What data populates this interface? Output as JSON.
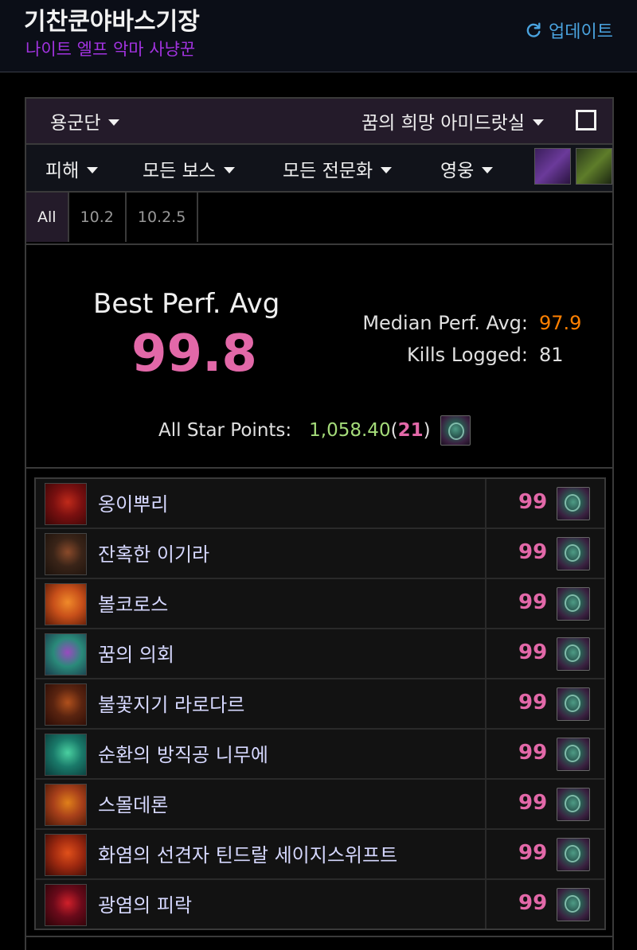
{
  "header": {
    "character_name": "기찬쿤야바스기장",
    "character_class": "나이트 엘프 악마 사냥꾼",
    "update_label": "업데이트"
  },
  "filters": {
    "region": "용군단",
    "raid": "꿈의 희망 아미드랏실",
    "metric": "피해",
    "boss": "모든 보스",
    "spec": "모든 전문화",
    "difficulty": "영웅"
  },
  "tabs": [
    "All",
    "10.2",
    "10.2.5"
  ],
  "summary": {
    "best_label": "Best Perf. Avg",
    "best_value": "99.8",
    "median_label": "Median Perf. Avg:",
    "median_value": "97.9",
    "kills_label": "Kills Logged:",
    "kills_value": "81",
    "allstar_label": "All Star Points:",
    "allstar_points": "1,058.40",
    "allstar_open": " (",
    "allstar_rank": "21",
    "allstar_close": ")"
  },
  "bosses": [
    {
      "name": "옹이뿌리",
      "score": "99",
      "icon": "boss-gnarlroot-icon",
      "colors": [
        "#7a1010",
        "#c02a1a",
        "#3a0606"
      ]
    },
    {
      "name": "잔혹한 이기라",
      "score": "99",
      "icon": "boss-igira-icon",
      "colors": [
        "#3a2418",
        "#8a4a2a",
        "#1c120c"
      ]
    },
    {
      "name": "볼코로스",
      "score": "99",
      "icon": "boss-volcoross-icon",
      "colors": [
        "#c8501a",
        "#f08a2a",
        "#5a1a08"
      ]
    },
    {
      "name": "꿈의 의회",
      "score": "99",
      "icon": "boss-council-of-dreams-icon",
      "colors": [
        "#2a8a7a",
        "#9a4ac0",
        "#1a3a4a"
      ]
    },
    {
      "name": "불꽃지기 라로다르",
      "score": "99",
      "icon": "boss-larodar-icon",
      "colors": [
        "#5a2410",
        "#b0501c",
        "#2a0c06"
      ]
    },
    {
      "name": "순환의 방직공 니무에",
      "score": "99",
      "icon": "boss-nymue-icon",
      "colors": [
        "#1a7a6a",
        "#4ad0a0",
        "#0a3a3a"
      ]
    },
    {
      "name": "스몰데론",
      "score": "99",
      "icon": "boss-smolderon-icon",
      "colors": [
        "#a8401a",
        "#e0801a",
        "#4a1808"
      ]
    },
    {
      "name": "화염의 선견자 틴드랄 세이지스위프트",
      "score": "99",
      "icon": "boss-tindral-icon",
      "colors": [
        "#a02a10",
        "#e0501a",
        "#3a0a06"
      ]
    },
    {
      "name": "광염의 피락",
      "score": "99",
      "icon": "boss-fyrakk-icon",
      "colors": [
        "#6a0a1a",
        "#d0202a",
        "#2a0408"
      ]
    }
  ],
  "colors": {
    "accent_pink": "#e268a8",
    "median_orange": "#ff8000",
    "allstar_green": "#a5dc7a",
    "class_purple": "#a233e0",
    "link_blue": "#4aa3df"
  }
}
